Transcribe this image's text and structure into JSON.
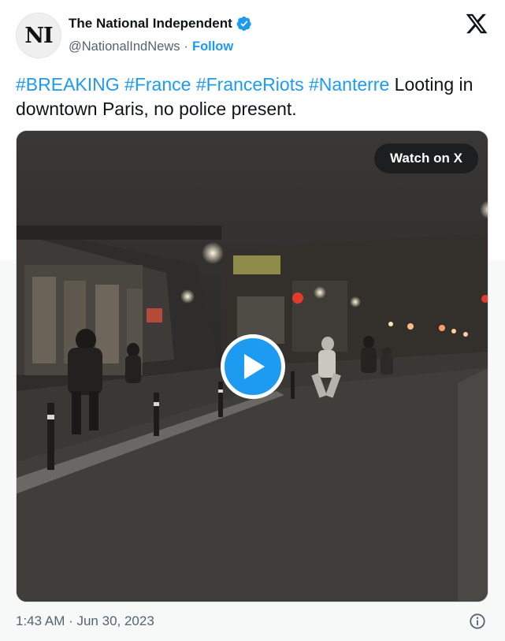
{
  "account": {
    "avatar_text": "NI",
    "display_name": "The National Independent",
    "handle": "@NationalIndNews",
    "separator": "·",
    "follow_label": "Follow",
    "verified_icon": "verified-badge-icon"
  },
  "tweet": {
    "hashtags": [
      "#BREAKING",
      "#France",
      "#FranceRiots",
      "#Nanterre"
    ],
    "body": "Looting in downtown Paris, no police present."
  },
  "media": {
    "watch_label": "Watch on X",
    "play_icon": "play-icon"
  },
  "footer": {
    "timestamp": "1:43 AM · Jun 30, 2023",
    "info_icon": "info-icon"
  },
  "colors": {
    "accent": "#1d9bf0",
    "text": "#0f1419",
    "muted": "#536471"
  }
}
